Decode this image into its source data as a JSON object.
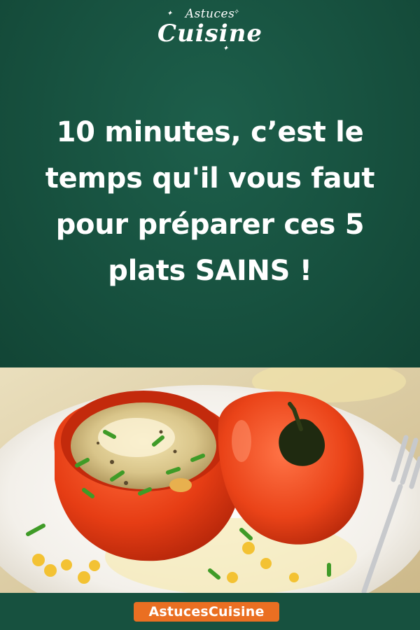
{
  "logo": {
    "line1": "Astuces",
    "line2": "Cuisine"
  },
  "headline": {
    "lines": [
      "10 minutes, c’est le",
      "temps qu'il vous faut",
      "pour préparer ces 5",
      "plats SAINS !"
    ]
  },
  "photo": {
    "subject": "stuffed-tomato-egg-icon"
  },
  "footer": {
    "brand": "AstucesCuisine"
  },
  "colors": {
    "background": "#17513f",
    "accent": "#ea6f22",
    "text": "#ffffff"
  }
}
